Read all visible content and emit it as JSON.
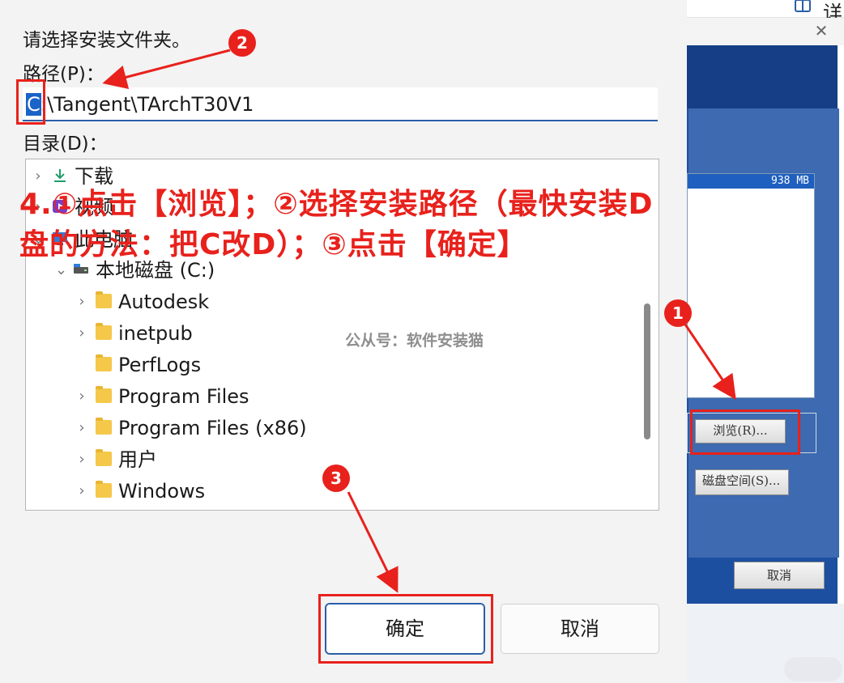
{
  "dialog": {
    "prompt": "请选择安装文件夹。",
    "path_label": "路径(P)：",
    "path_selected_char": "C",
    "path_rest": ":\\Tangent\\TArchT30V1",
    "dir_label": "目录(D)：",
    "tree": [
      {
        "label": "下载",
        "icon": "download-icon",
        "expandable": true
      },
      {
        "label": "视频",
        "icon": "video-icon",
        "expandable": true
      },
      {
        "label": "此电脑",
        "icon": "pc-icon",
        "expandable": true
      },
      {
        "label": "本地磁盘 (C:)",
        "icon": "drive-icon",
        "expanded": true
      },
      {
        "label": "Autodesk",
        "icon": "folder-icon",
        "expandable": true
      },
      {
        "label": "inetpub",
        "icon": "folder-icon",
        "expandable": true
      },
      {
        "label": "PerfLogs",
        "icon": "folder-icon",
        "expandable": false
      },
      {
        "label": "Program Files",
        "icon": "folder-icon",
        "expandable": true
      },
      {
        "label": "Program Files (x86)",
        "icon": "folder-icon",
        "expandable": true
      },
      {
        "label": "用户",
        "icon": "folder-icon",
        "expandable": true
      },
      {
        "label": "Windows",
        "icon": "folder-icon",
        "expandable": true
      }
    ],
    "ok_label": "确定",
    "cancel_label": "取消"
  },
  "background_window": {
    "help_text": "详",
    "size_text": "938 MB",
    "browse_label": "浏览(R)...",
    "disk_space_label": "磁盘空间(S)...",
    "cancel_label": "取消"
  },
  "annotations": {
    "overlay_line1": "4.①点击【浏览】；②选择安装路径（最快安装D",
    "overlay_line2": "盘的方法：把C改D）；③点击【确定】",
    "watermark": "公从号：软件安装猫",
    "badge_1": "1",
    "badge_2": "2",
    "badge_3": "3",
    "accent_color": "#e8211c"
  }
}
